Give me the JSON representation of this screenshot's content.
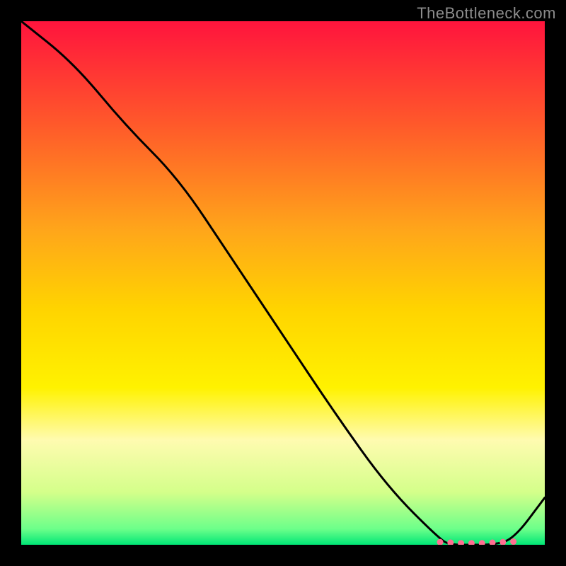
{
  "watermark": "TheBottleneck.com",
  "chart_data": {
    "type": "line",
    "title": "",
    "xlabel": "",
    "ylabel": "",
    "xlim": [
      0,
      100
    ],
    "ylim": [
      0,
      100
    ],
    "series": [
      {
        "name": "curve",
        "x": [
          0,
          10,
          20,
          30,
          40,
          50,
          60,
          70,
          80,
          82,
          86,
          90,
          94,
          100
        ],
        "values": [
          100,
          92,
          80,
          70,
          55,
          40,
          25,
          11,
          1,
          0,
          0,
          0,
          1,
          9
        ]
      }
    ],
    "markers": {
      "name": "pink-dots",
      "x": [
        80,
        82,
        84,
        86,
        88,
        90,
        92,
        94
      ],
      "values": [
        0.5,
        0.4,
        0.3,
        0.3,
        0.3,
        0.4,
        0.5,
        0.6
      ],
      "color": "#ff6f91"
    },
    "gradient_stops": [
      {
        "offset": 0,
        "color": "#ff143d"
      },
      {
        "offset": 20,
        "color": "#ff5a2a"
      },
      {
        "offset": 40,
        "color": "#ffa61a"
      },
      {
        "offset": 55,
        "color": "#ffd400"
      },
      {
        "offset": 70,
        "color": "#fff200"
      },
      {
        "offset": 80,
        "color": "#fffbb0"
      },
      {
        "offset": 90,
        "color": "#d4ff8a"
      },
      {
        "offset": 97,
        "color": "#6cff8a"
      },
      {
        "offset": 100,
        "color": "#00e676"
      }
    ]
  }
}
